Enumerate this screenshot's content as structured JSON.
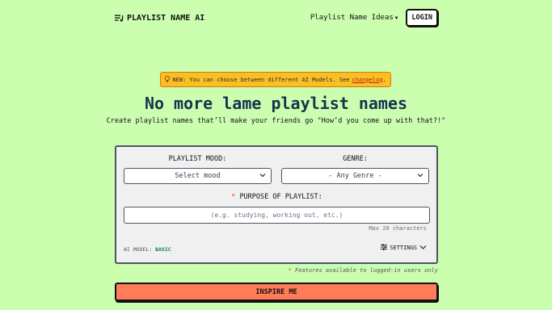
{
  "nav": {
    "brand": "PLAYLIST NAME AI",
    "brand_icon": "playlist-icon",
    "ideas_link": "Playlist Name Ideas",
    "login": "LOGIN"
  },
  "notice": {
    "icon": "lightbulb-icon",
    "text": "NEW: You can choose between different AI Models. See",
    "link": "changelog",
    "suffix": "."
  },
  "hero": {
    "title": "No more lame playlist names",
    "subtitle": "Create playlist names that’ll make your friends go \"How’d you come up with that?!\""
  },
  "form": {
    "mood_label": "PLAYLIST MOOD:",
    "mood_value": "Select mood",
    "genre_label": "GENRE:",
    "genre_value": "- Any Genre -",
    "required_mark": "*",
    "purpose_label": "PURPOSE OF PLAYLIST:",
    "purpose_placeholder": "(e.g. studying, working out, etc.)",
    "purpose_value": "",
    "max_chars": "Max 20 characters",
    "model_label": "AI MODEL:",
    "model_value": "BASIC",
    "settings": "SETTINGS"
  },
  "footnote": {
    "mark": "*",
    "text": "Features available to logged-in users only"
  },
  "cta": {
    "label": "INSPIRE ME"
  },
  "colors": {
    "background": "#ccfeb0",
    "notice": "#fbbf24",
    "cta": "#ff7c58",
    "title": "#17324d",
    "card": "#f1f0f1"
  }
}
